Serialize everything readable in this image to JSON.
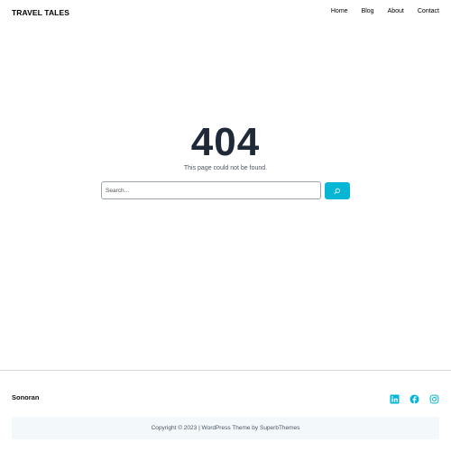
{
  "header": {
    "site_title": "TRAVEL TALES",
    "nav": [
      "Home",
      "Blog",
      "About",
      "Contact"
    ]
  },
  "main": {
    "error_code": "404",
    "message": "This page could not be found.",
    "search_placeholder": "Search...",
    "search_button_icon": "search-icon"
  },
  "footer": {
    "brand": "Sonoran",
    "social_icons": [
      "linkedin-icon",
      "facebook-icon",
      "instagram-icon"
    ],
    "copyright": "Copyright © 2023 | WordPress Theme by SuperbThemes"
  },
  "colors": {
    "accent": "#06b6d4",
    "heading": "#1f2937",
    "copyright_bg": "#f3f9fb"
  }
}
